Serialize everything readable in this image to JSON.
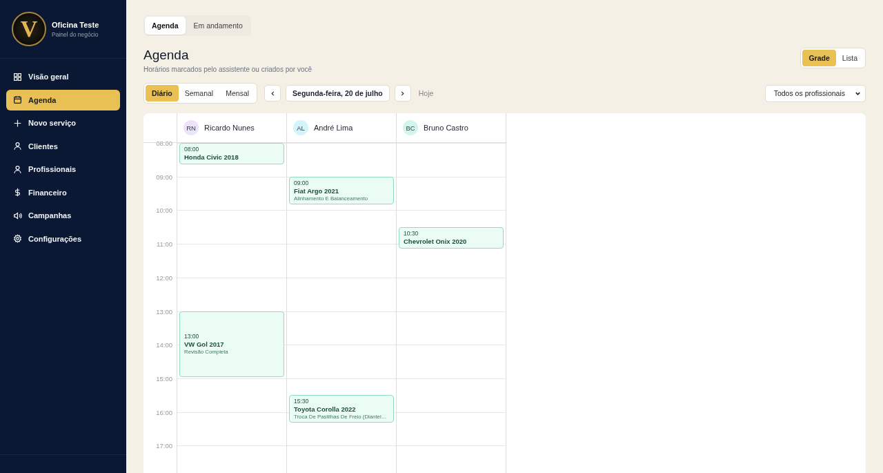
{
  "brand": {
    "logo_letter": "V",
    "name": "Oficina Teste",
    "subtitle": "Painel do negócio"
  },
  "nav": [
    {
      "label": "Visão geral",
      "selected": false
    },
    {
      "label": "Agenda",
      "selected": true
    },
    {
      "label": "Novo serviço",
      "selected": false
    },
    {
      "label": "Clientes",
      "selected": false
    },
    {
      "label": "Profissionais",
      "selected": false
    },
    {
      "label": "Financeiro",
      "selected": false
    },
    {
      "label": "Campanhas",
      "selected": false
    },
    {
      "label": "Configurações",
      "selected": false
    }
  ],
  "tabs": [
    {
      "label": "Agenda",
      "selected": true
    },
    {
      "label": "Em andamento",
      "selected": false
    }
  ],
  "title": "Agenda",
  "subtitle": "Horários marcados pelo assistente ou criados por você",
  "layout_toggle": [
    {
      "label": "Grade",
      "selected": true
    },
    {
      "label": "Lista",
      "selected": false
    }
  ],
  "periods": [
    {
      "label": "Diário",
      "selected": true
    },
    {
      "label": "Semanal",
      "selected": false
    },
    {
      "label": "Mensal",
      "selected": false
    }
  ],
  "date": "Segunda-feira, 20 de julho",
  "today": "Hoje",
  "filter": "Todos os profissionais",
  "hours": [
    "08:00",
    "09:00",
    "10:00",
    "11:00",
    "12:00",
    "13:00",
    "14:00",
    "15:00",
    "16:00",
    "17:00"
  ],
  "professionals": [
    {
      "initials": "RN",
      "name": "Ricardo Nunes",
      "color": "#ede3fb",
      "events": [
        {
          "time": "08:00",
          "vehicle": "Honda Civic 2018",
          "kind": "short"
        },
        {
          "time": "13:00",
          "vehicle": "VW Gol 2017",
          "service": "Revisão Completa",
          "kind": "long"
        }
      ]
    },
    {
      "initials": "AL",
      "name": "André Lima",
      "color": "#d3f4fa",
      "events": [
        {
          "time": "09:00",
          "vehicle": "Fiat Argo 2021",
          "service": "Alinhamento E Balanceamento",
          "kind": "medium"
        },
        {
          "time": "15:30",
          "vehicle": "Toyota Corolla 2022",
          "service": "Troca De Pastilhas De Freio (Diantei…",
          "kind": "medium"
        }
      ]
    },
    {
      "initials": "BC",
      "name": "Bruno Castro",
      "color": "#d2f5ec",
      "events": [
        {
          "time": "10:30",
          "vehicle": "Chevrolet Onix 2020",
          "kind": "short"
        }
      ]
    }
  ]
}
